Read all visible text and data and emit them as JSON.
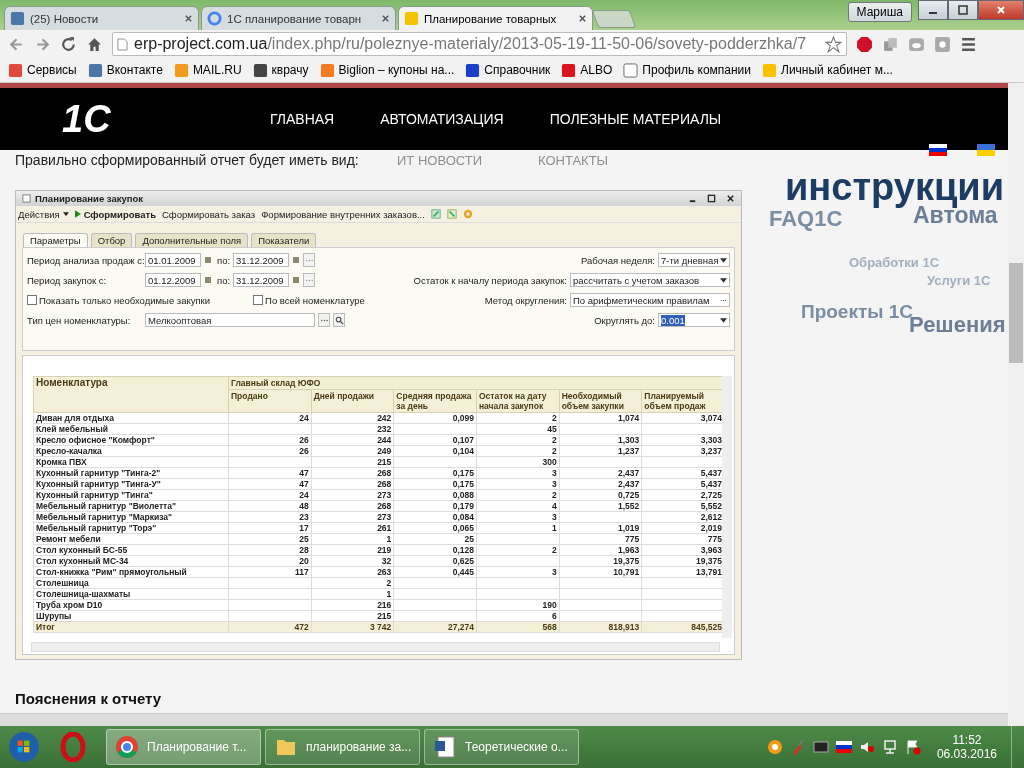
{
  "browser": {
    "tabs": [
      {
        "label": "(25) Новости",
        "selected": false
      },
      {
        "label": "1С планирование товарн",
        "selected": false
      },
      {
        "label": "Планирование товарных",
        "selected": true
      }
    ],
    "user": "Мариша",
    "address": {
      "host": "erp-project.com.ua",
      "path": "/index.php/ru/poleznye-materialy/2013-05-19-11-50-06/sovety-podderzhka/7"
    },
    "bookmarks": [
      "Сервисы",
      "Вконтакте",
      "MAIL.RU",
      "кврачу",
      "Biglion – купоны на...",
      "Справочник",
      "ALBO",
      "Профиль компании",
      "Личный кабинет м..."
    ]
  },
  "site": {
    "logo": "1C",
    "nav": [
      "ГЛАВНАЯ",
      "АВТОМАТИЗАЦИЯ",
      "ПОЛЕЗНЫЕ МАТЕРИАЛЫ"
    ],
    "intro": "Правильно сформированный отчет будет иметь вид:",
    "subnav": [
      "ИТ НОВОСТИ",
      "КОНТАКТЫ"
    ],
    "tag_cloud": [
      "инструкции",
      "FAQ1C",
      "Автома",
      "Обработки 1С",
      "Услуги 1С",
      "Проекты 1С",
      "Решения"
    ],
    "heading": "Пояснения к отчету"
  },
  "report_window": {
    "title": "Планирование закупок",
    "toolbar": [
      {
        "label": "Действия",
        "kind": "menu"
      },
      {
        "label": "Сформировать",
        "kind": "run"
      },
      {
        "label": "Сформировать заказ",
        "kind": "plain"
      },
      {
        "label": "Формирование внутренних заказов...",
        "kind": "plain"
      }
    ],
    "tabs": [
      {
        "label": "Параметры",
        "selected": true
      },
      {
        "label": "Отбор",
        "selected": false
      },
      {
        "label": "Дополнительные поля",
        "selected": false
      },
      {
        "label": "Показатели",
        "selected": false
      }
    ],
    "periods": [
      {
        "label": "Период анализа продаж с:",
        "from": "01.01.2009",
        "to_label": "по:",
        "to": "31.12.2009"
      },
      {
        "label": "Период закупок с:",
        "from": "01.12.2009",
        "to_label": "по:",
        "to": "31.12.2009"
      }
    ],
    "checkboxes": [
      {
        "label": "Показать только необходимые закупки",
        "checked": false
      },
      {
        "label": "По всей номенклатуре",
        "checked": false
      }
    ],
    "price_type": {
      "label": "Тип цен номенклатуры:",
      "value": "Мелкооптовая"
    },
    "settings": [
      {
        "label": "Рабочая неделя:",
        "value": "7-ти дневная",
        "kind": "select",
        "highlighted": false
      },
      {
        "label": "Остаток к началу периода закупок:",
        "value": "рассчитать с учетом заказов",
        "kind": "select",
        "highlighted": false
      },
      {
        "label": "Метод округления:",
        "value": "По арифметическим правилам",
        "kind": "picker",
        "highlighted": false
      },
      {
        "label": "Округлять до:",
        "value": "0.001",
        "kind": "select",
        "highlighted": true
      }
    ],
    "table": {
      "first_column": "Номенклатура",
      "group": "Главный склад ЮФО",
      "columns": [
        "Продано",
        "Дней продажи",
        "Средняя продажа за день",
        "Остаток на дату начала закупок",
        "Необходимый объем закупки",
        "Планируемый объем продаж"
      ],
      "rows": [
        {
          "name": "Диван для отдыха",
          "sold": "24",
          "days": "242",
          "avg": "0,099",
          "stock": "2",
          "need": "1,074",
          "plan": "3,074"
        },
        {
          "name": "Клей мебельный",
          "days": "232",
          "stock": "45"
        },
        {
          "name": "Кресло офисное \"Комфорт\"",
          "sold": "26",
          "days": "244",
          "avg": "0,107",
          "stock": "2",
          "need": "1,303",
          "plan": "3,303"
        },
        {
          "name": "Кресло-качалка",
          "sold": "26",
          "days": "249",
          "avg": "0,104",
          "stock": "2",
          "need": "1,237",
          "plan": "3,237"
        },
        {
          "name": "Кромка ПВХ",
          "days": "215",
          "stock": "300"
        },
        {
          "name": "Кухонный гарнитур \"Тинга-2\"",
          "sold": "47",
          "days": "268",
          "avg": "0,175",
          "stock": "3",
          "need": "2,437",
          "plan": "5,437"
        },
        {
          "name": "Кухонный гарнитур \"Тинга-У\"",
          "sold": "47",
          "days": "268",
          "avg": "0,175",
          "stock": "3",
          "need": "2,437",
          "plan": "5,437"
        },
        {
          "name": "Кухонный гарнитур \"Тинга\"",
          "sold": "24",
          "days": "273",
          "avg": "0,088",
          "stock": "2",
          "need": "0,725",
          "plan": "2,725"
        },
        {
          "name": "Мебельный гарнитур \"Виолетта\"",
          "sold": "48",
          "days": "268",
          "avg": "0,179",
          "stock": "4",
          "need": "1,552",
          "plan": "5,552"
        },
        {
          "name": "Мебельный гарнитур \"Маркиза\"",
          "sold": "23",
          "days": "273",
          "avg": "0,084",
          "stock": "3",
          "plan": "2,612"
        },
        {
          "name": "Мебельный гарнитур \"Торэ\"",
          "sold": "17",
          "days": "261",
          "avg": "0,065",
          "stock": "1",
          "need": "1,019",
          "plan": "2,019"
        },
        {
          "name": "Ремонт мебели",
          "sold": "25",
          "days": "1",
          "avg": "25",
          "need": "775",
          "plan": "775"
        },
        {
          "name": "Стол кухонный БС-55",
          "sold": "28",
          "days": "219",
          "avg": "0,128",
          "stock": "2",
          "need": "1,963",
          "plan": "3,963"
        },
        {
          "name": "Стол кухонный МС-34",
          "sold": "20",
          "days": "32",
          "avg": "0,625",
          "need": "19,375",
          "plan": "19,375"
        },
        {
          "name": "Стол-книжка \"Рим\" прямоугольный",
          "sold": "117",
          "days": "263",
          "avg": "0,445",
          "stock": "3",
          "need": "10,791",
          "plan": "13,791"
        },
        {
          "name": "Столешница",
          "days": "2"
        },
        {
          "name": "Столешница-шахматы",
          "days": "1"
        },
        {
          "name": "Труба хром D10",
          "days": "216",
          "stock": "190"
        },
        {
          "name": "Шурупы",
          "days": "215",
          "stock": "6"
        }
      ],
      "total": {
        "name": "Итог",
        "sold": "472",
        "days": "3 742",
        "avg": "27,274",
        "stock": "568",
        "need": "818,913",
        "plan": "845,525"
      }
    }
  },
  "taskbar": {
    "items": [
      {
        "label": "Планирование т...",
        "active": true
      },
      {
        "label": "планирование за...",
        "active": false
      },
      {
        "label": "Теоретические о...",
        "active": false
      }
    ],
    "time": "11:52",
    "date": "06.03.2016"
  }
}
